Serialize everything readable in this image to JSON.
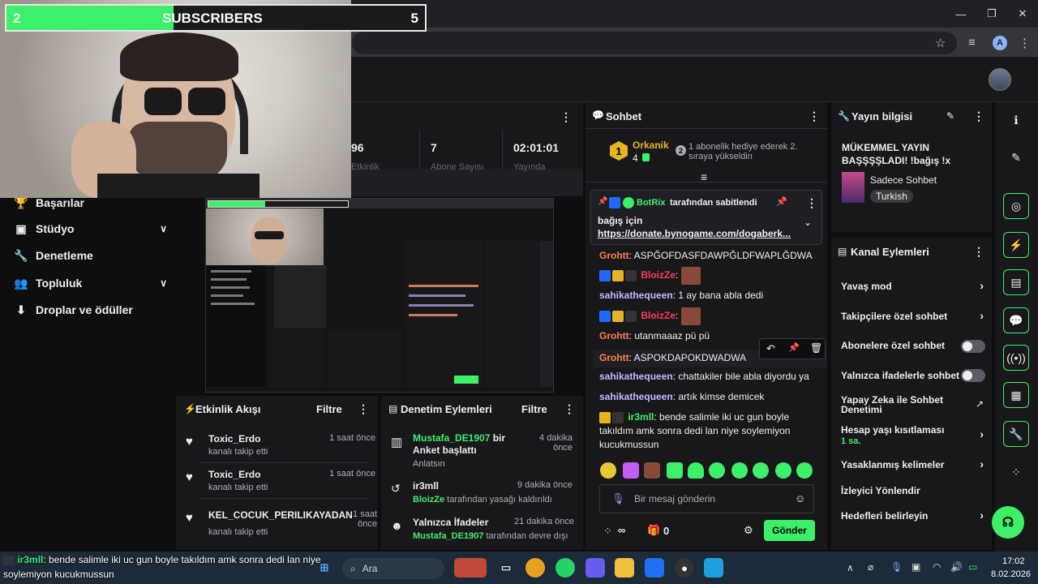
{
  "overlay": {
    "sub_count_left": "2",
    "sub_label": "SUBSCRIBERS",
    "sub_goal": "5",
    "sub_progress": 0.4
  },
  "nav": {
    "items": [
      {
        "label": "Başarılar",
        "icon": "trophy-icon"
      },
      {
        "label": "Stüdyo",
        "icon": "studio-icon"
      },
      {
        "label": "Denetleme",
        "icon": "wrench-icon"
      },
      {
        "label": "Topluluk",
        "icon": "community-icon"
      },
      {
        "label": "Droplar ve ödüller",
        "icon": "drops-icon"
      }
    ]
  },
  "stats": {
    "partial": "96",
    "partial_label": "Etkinlik",
    "followers": "7",
    "followers_label": "Abone Sayısı",
    "uptime": "02:01:01",
    "uptime_label": "Yayında"
  },
  "activity": {
    "title": "Etkinlik Akışı",
    "filter": "Filtre",
    "items": [
      {
        "name": "Toxic_Erdo",
        "sub": "kanalı takip etti",
        "time": "1 saat önce"
      },
      {
        "name": "Toxic_Erdo",
        "sub": "kanalı takip etti",
        "time": "1 saat önce"
      },
      {
        "name": "KEL_COCUK_PERILIKAYADAN",
        "sub": "kanalı takip etti",
        "time": "1 saat önce"
      }
    ]
  },
  "moderation": {
    "title": "Denetim Eylemleri",
    "filter": "Filtre",
    "items": [
      {
        "actor": "Mustafa_DE1907",
        "text": " bir Anket başlattı",
        "sub": "Anlatsın",
        "time": "4 dakika önce"
      },
      {
        "actor": "ir3mll",
        "text": "",
        "sub_actor": "BloizZe",
        "sub": " tarafından yasağı kaldırıldı",
        "time": "9 dakika önce"
      },
      {
        "actor": "Yalnızca İfadeler",
        "text": "",
        "sub_actor": "Mustafa_DE1907",
        "sub": " tarafından devre dışı",
        "time": "21 dakika önce"
      }
    ]
  },
  "chat": {
    "title": "Sohbet",
    "top_user": "Orkanik",
    "top_count": "4",
    "top_rank": "1",
    "gift_rank": "2",
    "gift_text": "1 abonelik hediye ederek 2. sıraya yükseldin",
    "pinned_by": "BotRix",
    "pinned_suffix": "tarafından sabitlendi",
    "pinned_text": "bağış için",
    "pinned_link": "https://donate.bynogame.com/dogaberk...",
    "messages": [
      {
        "user": "Grohtt",
        "color": "#ff7f50",
        "text": "ASPĞOFDASFDAWPĞLDFWAPLĞDWA"
      },
      {
        "user": "BloizZe",
        "color": "#ff3c5a",
        "text": ""
      },
      {
        "user": "sahikathequeen",
        "color": "#c9b8ff",
        "text": "1 ay bana abla dedi"
      },
      {
        "user": "BloizZe",
        "color": "#ff3c5a",
        "text": ""
      },
      {
        "user": "Grohtt",
        "color": "#ff7f50",
        "text": "utanmaaaz pü pü"
      },
      {
        "user": "Grohtt",
        "color": "#ff7f50",
        "text": "ASPOKDAPOKDWADWA"
      },
      {
        "user": "sahikathequeen",
        "color": "#c9b8ff",
        "text": "chattakiler bile abla diyordu ya"
      },
      {
        "user": "sahikathequeen",
        "color": "#c9b8ff",
        "text": "artık kimse demicek"
      },
      {
        "user": "ir3mll",
        "color": "#3cf06a",
        "text": "bende salimle iki uc gun boyle takıldım amk sonra dedi lan niye soylemiyon kucukmussun"
      }
    ],
    "input_placeholder": "Bir mesaj gönderin",
    "points": "∞",
    "gifts": "0",
    "send": "Gönder"
  },
  "stream_info": {
    "title": "Yayın bilgisi",
    "stream_title": "MÜKEMMEL YAYIN BAŞŞŞŞLADI! !bağış !x",
    "category": "Sadece Sohbet",
    "tag": "Turkish"
  },
  "channel_actions": {
    "title": "Kanal Eylemleri",
    "items": [
      {
        "label": "Yavaş mod",
        "control": "chevron"
      },
      {
        "label": "Takipçilere özel sohbet",
        "control": "chevron"
      },
      {
        "label": "Abonelere özel sohbet",
        "control": "toggle"
      },
      {
        "label": "Yalnızca ifadelerle sohbet",
        "control": "toggle"
      },
      {
        "label": "Yapay Zeka ile Sohbet Denetimi",
        "control": "external"
      },
      {
        "label": "Hesap yaşı kısıtlaması",
        "sub": "1 sa.",
        "control": "chevron"
      },
      {
        "label": "Yasaklanmış kelimeler",
        "control": "chevron"
      },
      {
        "label": "İzleyici Yönlendir",
        "control": "none"
      },
      {
        "label": "Hedefleri belirleyin",
        "control": "chevron"
      }
    ]
  },
  "taskbar": {
    "search": "Ara",
    "time": "17:02",
    "date": "8.02.2026"
  },
  "ticker": {
    "user": "ir3mll",
    "text": ": bende salimle iki uc gun boyle takıldım amk sonra dedi lan niye",
    "text2": "soylemiyon kucukmussun"
  },
  "colors": {
    "accent": "#3cf06a",
    "panel": "#18181b",
    "bg": "#0e0e10"
  }
}
